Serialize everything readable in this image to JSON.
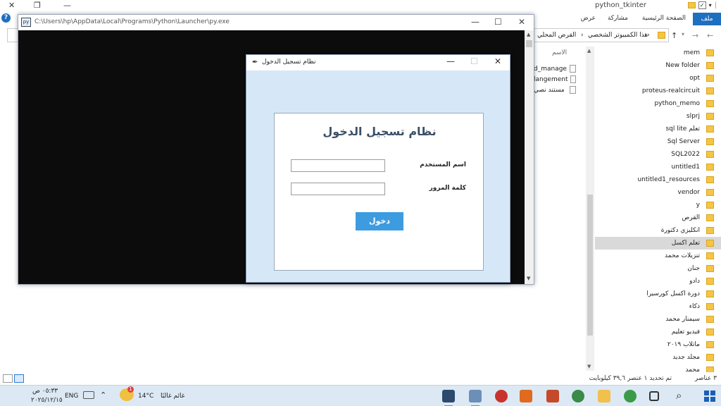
{
  "explorer": {
    "title": "python_tkinter",
    "ribbon_tabs": [
      "ملف",
      "الصفحة الرئيسية",
      "مشاركة",
      "عرض"
    ],
    "address_crumbs": [
      "هذا الكمبيوتر الشخصي",
      "القرص المحلي"
    ],
    "column_header": "الاسم",
    "files": [
      "d_manage",
      "langement",
      "مستند نصي"
    ],
    "tree_items": [
      "mem",
      "New folder",
      "opt",
      "proteus-realcircuit",
      "python_memo",
      "slprj",
      "sql lite تعلم",
      "Sql Server",
      "SQL2022",
      "untitled1",
      "untitled1_resources",
      "vendor",
      "y",
      "القرص",
      "انكليزي دكتورة",
      "تعلم اكسل",
      "تنزيلات محمد",
      "جنان",
      "دادو",
      "دورة اكسل كورسيرا",
      "ذكاء",
      "سيمنار محمد",
      "فيديو تعليم",
      "ماتلاب ٢٠١٩",
      "مجلد جديد",
      "محمد"
    ],
    "selected_tree_item": "تعلم اكسل",
    "status": {
      "count": "٣ عناصر",
      "selection": "تم تحديد ١ عنصر ٣٩,٦ كيلوبايت"
    }
  },
  "console": {
    "title": "C:\\Users\\hp\\AppData\\Local\\Programs\\Python\\Launcher\\py.exe"
  },
  "login": {
    "window_title": "نظام تسجيل الدخول",
    "heading": "نظام تسجيل الدخول",
    "username_label": "اسم المستخدم",
    "username_value": "",
    "password_label": "كلمة المرور",
    "password_value": "",
    "submit_label": "دخول"
  },
  "taskbar": {
    "time": "٠٥:٣٣ ص",
    "date": "٢٠٢٥/١٢/١٥",
    "language": "ENG",
    "temperature": "14°C",
    "weather": "غائم غالبًا",
    "weather_badge": "1"
  },
  "colors": {
    "accent": "#1f6fc0",
    "login_bg": "#d6e8f7",
    "login_button": "#3d9be0",
    "console_bg": "#0c0c0c",
    "taskbar_bg": "#dce9f4"
  }
}
